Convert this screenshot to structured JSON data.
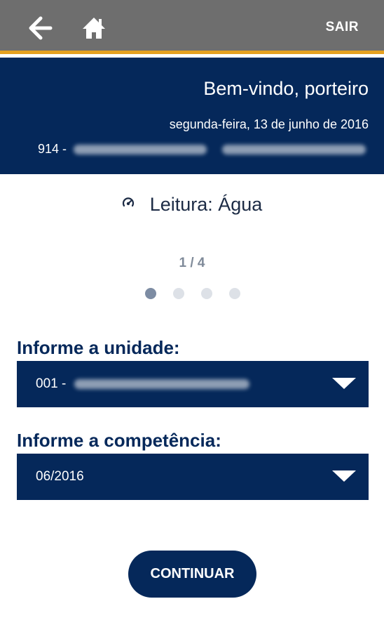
{
  "topbar": {
    "back_icon": "arrow-left-icon",
    "home_icon": "home-icon",
    "exit_label": "SAIR"
  },
  "header": {
    "welcome": "Bem-vindo, porteiro",
    "date": "segunda-feira, 13 de junho de 2016",
    "condo_code": "914 -"
  },
  "reading": {
    "icon": "gauge-icon",
    "title": "Leitura: Água",
    "pager": "1 / 4",
    "steps_total": 4,
    "step_active": 1
  },
  "form": {
    "unit_label": "Informe a unidade:",
    "unit_value": "001 -",
    "period_label": "Informe a competência:",
    "period_value": "06/2016"
  },
  "actions": {
    "continue_label": "CONTINUAR"
  },
  "colors": {
    "topbar": "#6e6e6e",
    "accent": "#e6a120",
    "primary": "#05285a"
  }
}
